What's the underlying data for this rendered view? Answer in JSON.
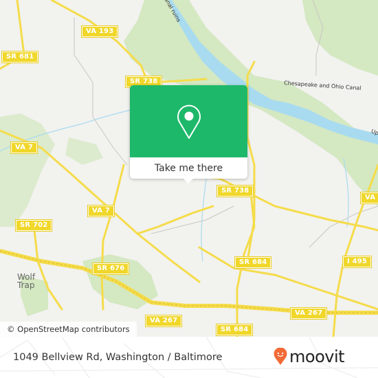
{
  "map": {
    "road_labels": [
      {
        "id": "va-193",
        "text": "VA 193"
      },
      {
        "id": "sr-681",
        "text": "SR 681"
      },
      {
        "id": "sr-738-north",
        "text": "SR 738"
      },
      {
        "id": "va-7-west",
        "text": "VA 7"
      },
      {
        "id": "sr-738-east",
        "text": "SR 738"
      },
      {
        "id": "va-partial-east",
        "text": "VA"
      },
      {
        "id": "sr-702",
        "text": "SR 702"
      },
      {
        "id": "va-7-south",
        "text": "VA 7"
      },
      {
        "id": "sr-676",
        "text": "SR 676"
      },
      {
        "id": "sr-684-north",
        "text": "SR 684"
      },
      {
        "id": "i-495",
        "text": "I 495"
      },
      {
        "id": "va-267-west",
        "text": "VA 267"
      },
      {
        "id": "va-267-east",
        "text": "VA 267"
      },
      {
        "id": "sr-684-south",
        "text": "SR 684"
      }
    ],
    "place_labels": {
      "wolf_trap_line1": "Wolf",
      "wolf_trap_line2": "Trap"
    },
    "water_labels": {
      "canal": "Chesapeake and Ohio Canal",
      "canal_ruins": "canal ruins",
      "upper_partial": "Up"
    },
    "attribution": "© OpenStreetMap contributors",
    "colors": {
      "background": "#f2f2ef",
      "park": "#d4e8c2",
      "water": "#a8dbef",
      "road": "#f5dc4a",
      "shield": "#f0d72a"
    }
  },
  "popup": {
    "button_label": "Take me there",
    "icon": "location-pin-icon",
    "accent": "#1eb86a"
  },
  "footer": {
    "address": "1049 Bellview Rd, Washington / Baltimore",
    "brand": "moovit",
    "brand_color": "#f26a36"
  }
}
